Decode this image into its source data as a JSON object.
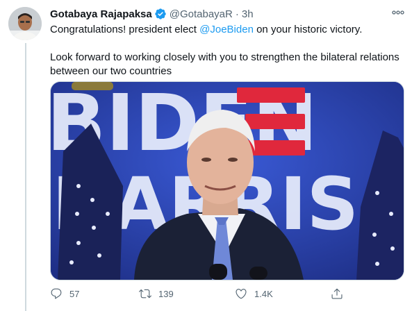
{
  "tweet": {
    "author_name": "Gotabaya Rajapaksa",
    "handle": "@GotabayaR",
    "separator": "·",
    "time": "3h",
    "text_line1_prefix": "Congratulations! president elect ",
    "mention": "@JoeBiden",
    "text_line1_suffix": " on your historic victory.",
    "text_paragraph2": "Look forward to working closely with you to strengthen the bilateral relations between our two countries"
  },
  "media": {
    "alt_words": [
      "BIDEN",
      "HARRIS"
    ]
  },
  "actions": {
    "replies": "57",
    "retweets": "139",
    "likes": "1.4K"
  },
  "icons": {
    "verified": "verified-badge-icon",
    "more": "more-options-icon",
    "reply": "reply-icon",
    "retweet": "retweet-icon",
    "like": "heart-icon",
    "share": "share-icon"
  },
  "colors": {
    "accent": "#1d9bf0",
    "secondary_text": "#536471",
    "primary_text": "#0f1419",
    "stage_blue": "#2f48b8",
    "stripe_red": "#e0283c"
  }
}
